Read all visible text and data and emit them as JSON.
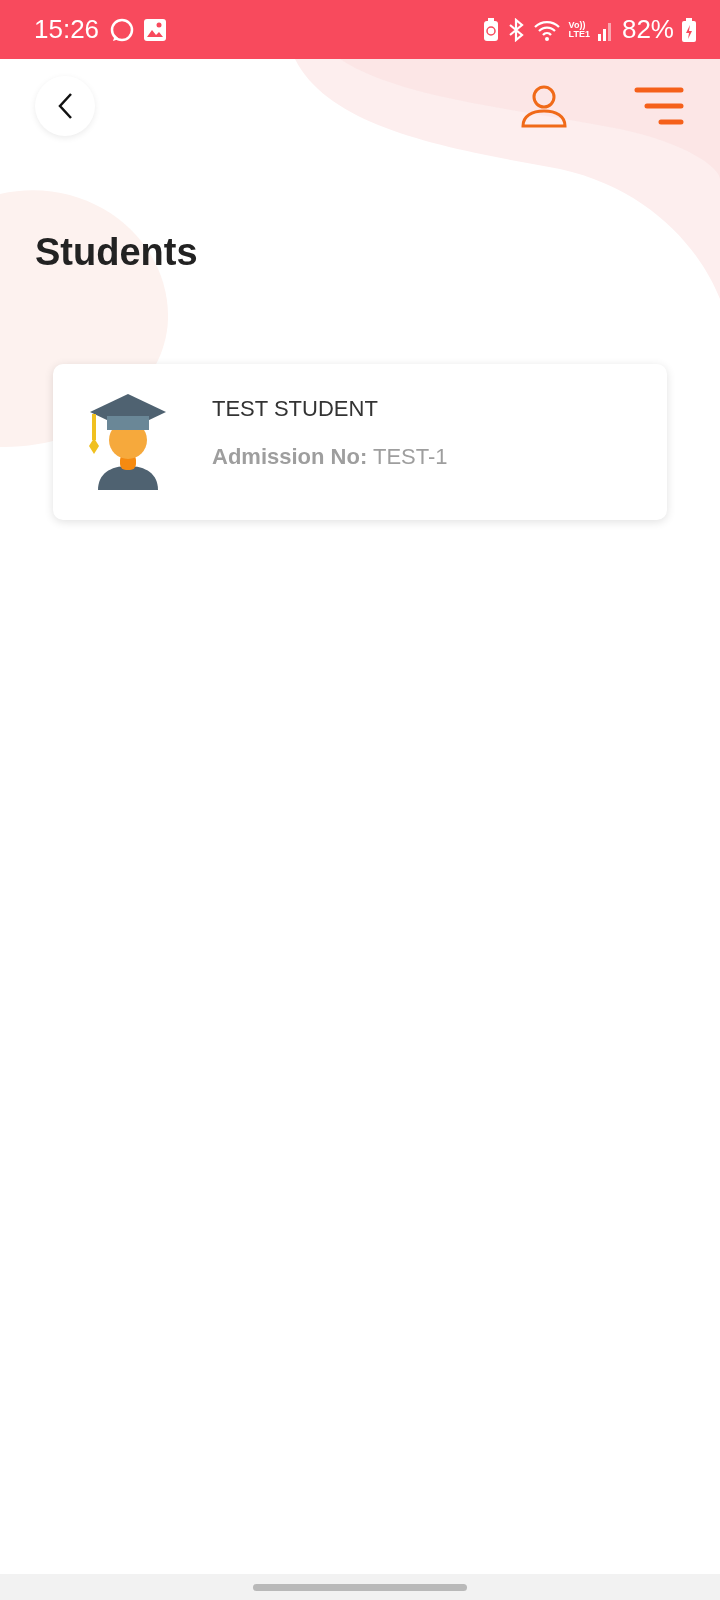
{
  "status_bar": {
    "time": "15:26",
    "network_top": "Vo))",
    "network_bottom": "LTE1",
    "battery": "82%"
  },
  "header": {
    "title": "Students"
  },
  "students": [
    {
      "name": "TEST STUDENT",
      "admission_label": "Admission No:",
      "admission_value": "TEST-1"
    }
  ]
}
